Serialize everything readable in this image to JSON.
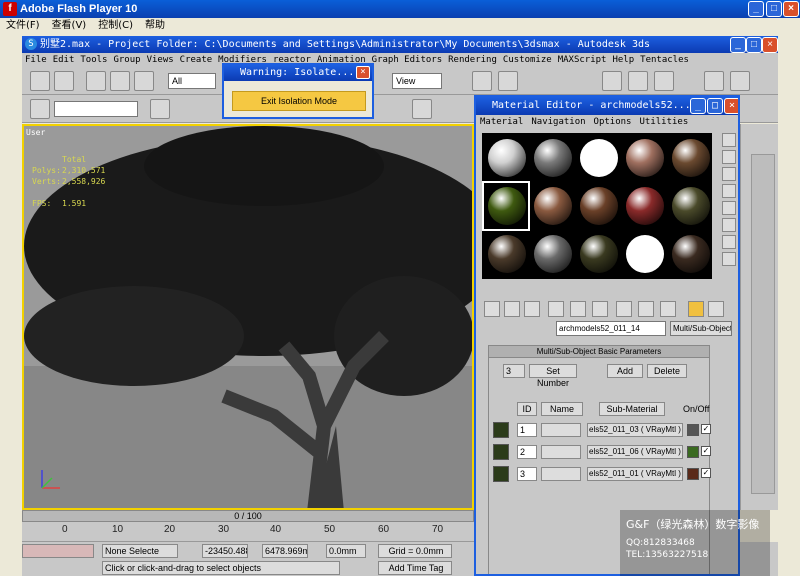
{
  "flash": {
    "title": "Adobe Flash Player 10",
    "logo": "f",
    "menu": [
      "文件(F)",
      "查看(V)",
      "控制(C)",
      "帮助"
    ]
  },
  "max": {
    "title": "别墅2.max    - Project Folder: C:\\Documents and Settings\\Administrator\\My Documents\\3dsmax   - Autodesk 3ds",
    "menu": [
      "File",
      "Edit",
      "Tools",
      "Group",
      "Views",
      "Create",
      "Modifiers",
      "reactor",
      "Animation",
      "Graph Editors",
      "Rendering",
      "Customize",
      "MAXScript",
      "Help",
      "Tentacles"
    ],
    "selection_filter": "All",
    "view_dropdown": "View"
  },
  "viewport": {
    "label": "User",
    "stats": {
      "header": "Total",
      "polys_label": "Polys:",
      "polys": "2,310,571",
      "verts_label": "Verts:",
      "verts": "2,558,926",
      "fps_label": "FPS:",
      "fps": "1.591"
    }
  },
  "warning": {
    "title": "Warning: Isolate...",
    "button": "Exit Isolation Mode"
  },
  "material_editor": {
    "title": "Material Editor - archmodels52...",
    "menu": [
      "Material",
      "Navigation",
      "Options",
      "Utilities"
    ],
    "material_name": "archmodels52_011_14",
    "material_type": "Multi/Sub-Object",
    "rollout_title": "Multi/Sub-Object Basic Parameters",
    "count": "3",
    "set_number": "Set Number",
    "add": "Add",
    "delete": "Delete",
    "col_id": "ID",
    "col_name": "Name",
    "col_submaterial": "Sub-Material",
    "col_onoff": "On/Off",
    "rows": [
      {
        "id": "1",
        "material": "els52_011_03 ( VRayMtl )",
        "color": "#555555",
        "checked": "✓"
      },
      {
        "id": "2",
        "material": "els52_011_06 ( VRayMtl )",
        "color": "#3a6a20",
        "checked": "✓"
      },
      {
        "id": "3",
        "material": "els52_011_01 ( VRayMtl )",
        "color": "#5a2a1a",
        "checked": "✓"
      }
    ],
    "sphere_colors": [
      "#d0d0d0",
      "#7a7a7a",
      "#ffffff",
      "#a07060",
      "#6b4a30",
      "#3f5a10",
      "#8a5a40",
      "#6a4028",
      "#8a2a2a",
      "#4a4a2a",
      "#4a3a2a",
      "#6a6a6a",
      "#3a3a20",
      "#ffffff",
      "#3a2a20"
    ]
  },
  "timeline": {
    "frame": "0 / 100",
    "ticks": [
      "0",
      "10",
      "20",
      "30",
      "40",
      "50",
      "60",
      "70"
    ]
  },
  "status": {
    "none_selected": "None Selecte",
    "x": "-23450.488",
    "y": "6478.969m",
    "z": "0.0mm",
    "grid": "Grid = 0.0mm",
    "prompt": "Click or click-and-drag to select objects",
    "add_time_tag": "Add Time Tag"
  },
  "watermark": {
    "line1": "G&F（绿光森林）数字影像",
    "line2": "QQ:812833468",
    "line3": "TEL:13563227518"
  }
}
